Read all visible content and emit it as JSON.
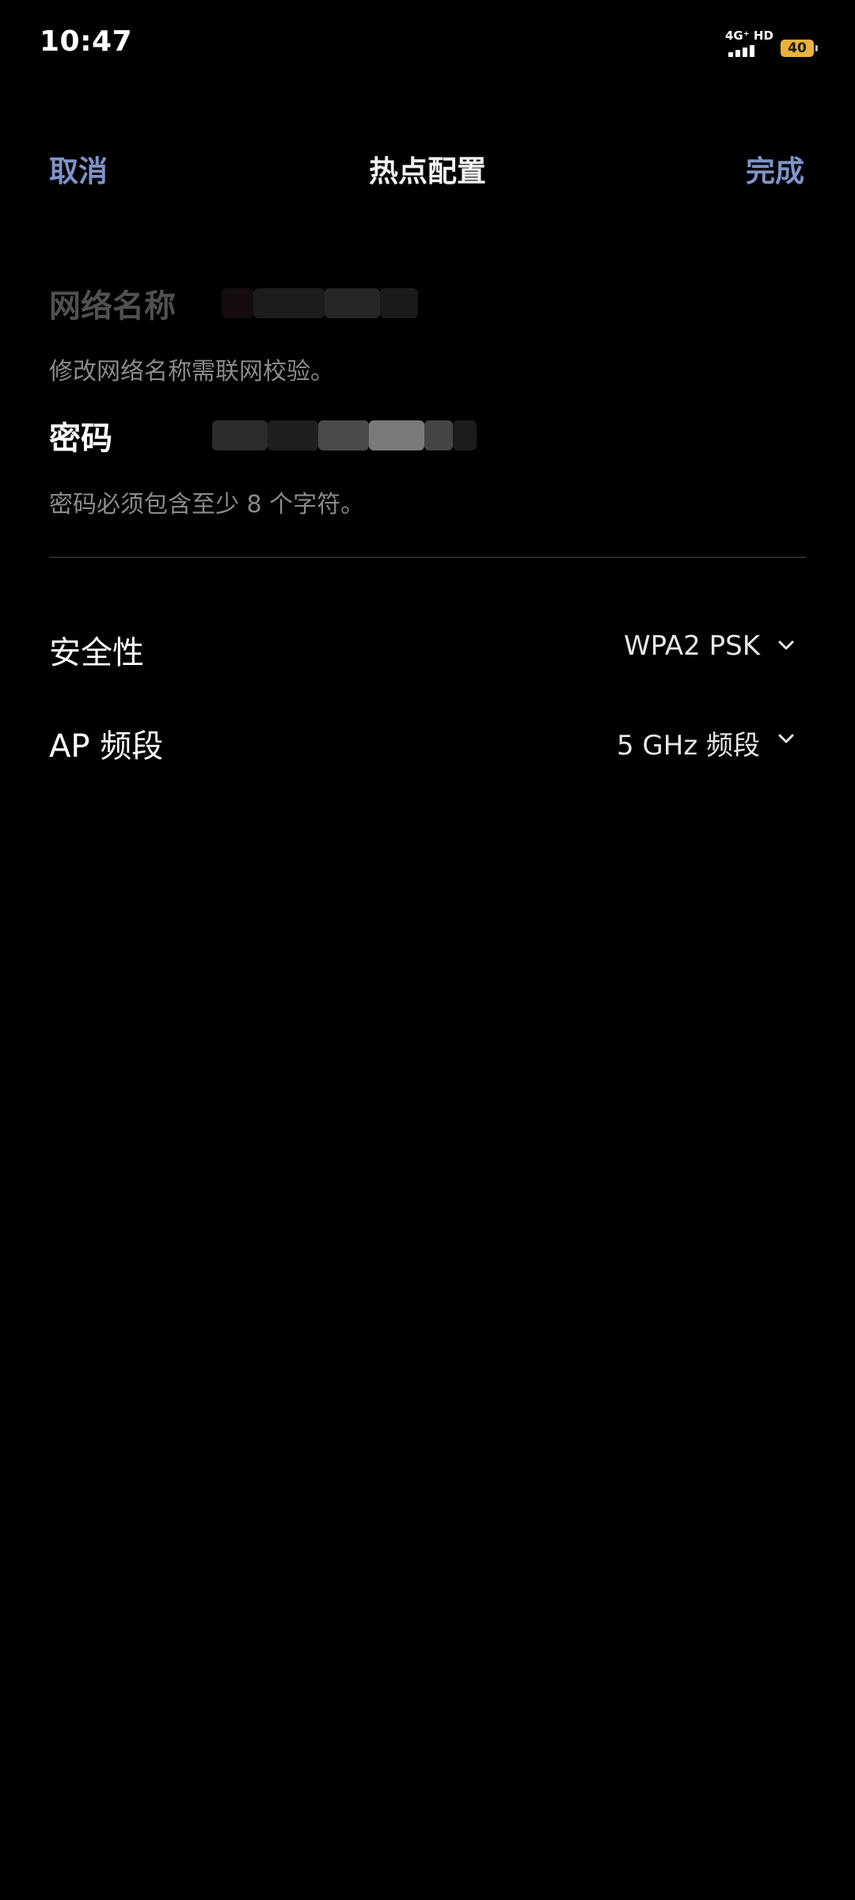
{
  "status_bar": {
    "time": "10:47",
    "network_label": "4G⁺ HD",
    "signal_icon": "signal-bars-icon",
    "battery_level": "40",
    "battery_color": "#e9b23a"
  },
  "header": {
    "cancel_label": "取消",
    "title": "热点配置",
    "done_label": "完成",
    "accent_color": "#7f93c9"
  },
  "form": {
    "network_name": {
      "label": "网络名称",
      "hint": "修改网络名称需联网校验。"
    },
    "password": {
      "label": "密码",
      "hint": "密码必须包含至少 8 个字符。"
    }
  },
  "settings": {
    "security": {
      "label": "安全性",
      "value": "WPA2 PSK",
      "icon": "chevron-down-icon"
    },
    "ap_band": {
      "label": "AP 频段",
      "value": "5 GHz 频段",
      "icon": "chevron-down-icon"
    }
  }
}
